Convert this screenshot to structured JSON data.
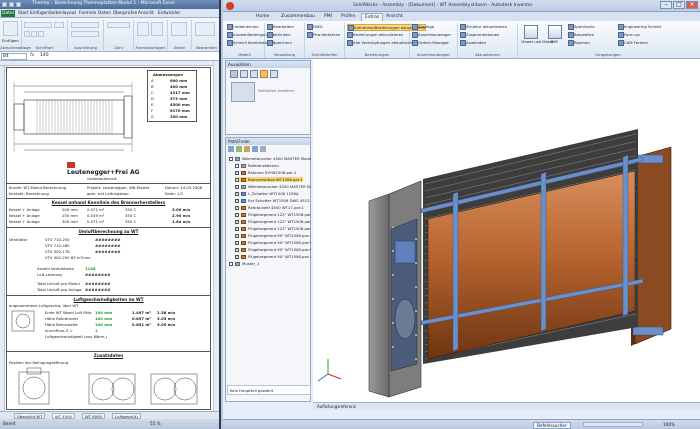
{
  "excel": {
    "title": "Thermo... Berechnung  Thermoplatten-Modul 1 - Microsoft Excel",
    "file_tab": "Datei",
    "tabs": [
      "Start",
      "Einfügen",
      "Seitenlayout",
      "Formeln",
      "Daten",
      "Überprüfen",
      "Ansicht",
      "Entwickler"
    ],
    "groups": [
      "Zwischenablage",
      "Schriftart",
      "Ausrichtung",
      "Zahl",
      "Formatvorlagen",
      "Zellen",
      "Bearbeiten"
    ],
    "paste_label": "Einfügen",
    "name_box": "B4",
    "fx": "fx",
    "formula_value": "140",
    "sheet": {
      "dims_header": "Abmessungen",
      "dims": [
        {
          "k": "A",
          "v": "600 mm"
        },
        {
          "k": "B",
          "v": "400 mm"
        },
        {
          "k": "C",
          "v": "4317 mm"
        },
        {
          "k": "D",
          "v": "573 mm"
        },
        {
          "k": "E",
          "v": "4500 mm"
        },
        {
          "k": "F",
          "v": "6170 mm"
        },
        {
          "k": "G",
          "v": "200 mm"
        }
      ],
      "company": "Leutenegger+Frei AG",
      "company_sub": "Gartenbautechnik",
      "info_lines": [
        {
          "l": "Kunde: WT-Modul-Berechnung",
          "m": "Projekt: Leutenegger, WB Muster",
          "r": "Datum: 14.03.2008"
        },
        {
          "l": "Kontakt: Berechnung",
          "m": "gem. mit Leitungsbau",
          "r": "Seite: 1/1"
        }
      ],
      "kessel_header": "Kessel anhand Kennlinie des Brennerherstellers",
      "kessel_rows": [
        {
          "a": "Kessel + Anlage",
          "b": "200 mm",
          "c": "0.071 m²",
          "d": "350 C",
          "e": "3.00 m/s"
        },
        {
          "a": "Kessel + Anlage",
          "b": "250 mm",
          "c": "0.049 m²",
          "d": "350 C",
          "e": "2.90 m/s"
        },
        {
          "a": "Kessel + Anlage",
          "b": "300 mm",
          "c": "0.071 m²",
          "d": "350 C",
          "e": "1.84 m/s"
        }
      ],
      "umluft_header": "Umluftberechnung zu WT",
      "umluft_label": "Ventilator",
      "umluft_rows": [
        "VTV 710-250",
        "VTV 710-280",
        "VTV 500-178",
        "VTV 400-250  65 m³/min"
      ],
      "umluft_hashes": "########",
      "anzahl_label": "Anzahl Ventilatoren",
      "anzahl_value": "1146",
      "luft_label": "Luft-Leistung",
      "total_labels": [
        "Total Umluft pro Modul",
        "Total Umluft pro Anlage"
      ],
      "waerme_header": "Luftgeschwindigkeiten im WT",
      "waerme_sub": "angenommene Luftgeschw. über WT",
      "waerme_rows": [
        {
          "l": "Ende WT Wand Luft Rille",
          "v": "100 mm",
          "x": "1.497 m²",
          "y": "2.58 m/s"
        },
        {
          "l": "Höhe Rohrbündel",
          "v": "100 mm",
          "x": "0.897 m²",
          "y": "3.05 m/s"
        },
        {
          "l": "Höhe Brennweite",
          "v": "100 mm",
          "x": "0.851 m²",
          "y": "3.05 m/s"
        },
        {
          "l": "durchfluss Z =",
          "v": "1",
          "x": "",
          "y": ""
        },
        {
          "l": "Luftgeschwindigkeit (aus Wärm.)",
          "v": "",
          "x": "",
          "y": ""
        }
      ],
      "zusatz_header": "Zusatzdaten",
      "position_label": "Position der Reinigungsöffnung"
    },
    "sheet_tabs": [
      "Übersicht WT",
      "WT 4500",
      "WT 6000",
      "Luftgesch(t)"
    ],
    "status": {
      "ready": "Bereit",
      "zoom": "55 %"
    }
  },
  "cad": {
    "title": "SolidWorks - Assembly - [Dokument] - WT Assembly.sldasm - Autodesk Inventor",
    "window_controls": [
      "–",
      "□",
      "✕"
    ],
    "tabs": [
      "Home",
      "Zusammenbau",
      "PMI",
      "Prüfen",
      "Extras",
      "Ansicht"
    ],
    "active_tab": "Extras",
    "groups": [
      {
        "label": "Modell",
        "items": [
          "Umbenennen",
          "Auswahlbedingungen",
          "Schnell Kombinatoren"
        ]
      },
      {
        "label": "Verwaltung",
        "items": [
          "Bearbeiten",
          "Verlinken",
          "Speichern"
        ]
      },
      {
        "label": "Schnittstellen",
        "items": [
          "DWG",
          "Pkw-Verfahren"
        ]
      },
      {
        "label": "Beziehungen",
        "items": [
          "Aufnahme/Beziehungen aktualisieren",
          "Beziehungen aktualisieren",
          "Alle Verknüpfungen aktualisieren"
        ]
      },
      {
        "label": "Ansichtsmanager",
        "items": [
          "Auszüge",
          "Ansichtsmanager",
          "Ordner-Manager"
        ]
      },
      {
        "label": "Aktualisieren",
        "items": [
          "Struktur aktualisieren",
          "Zusammenbauen",
          "Anwenden"
        ]
      },
      {
        "label": "Umgebungen",
        "items": [
          "Sperrfache",
          "Baustellen",
          "Raumen",
          "Engineering Schnitt",
          "Form-up",
          "CAM Formen"
        ]
      }
    ],
    "big_buttons": [
      "Viewer und Maker",
      "BIM"
    ],
    "selection_panel": {
      "header": "Auswählen",
      "button": "Definition erstellen"
    },
    "tree_panel": {
      "header": "PathFinder",
      "items": [
        {
          "text": "Wärmetauscher 4500 MASTER Montage.asm",
          "icon": "grey",
          "check": false,
          "indent": 0,
          "sel": false
        },
        {
          "text": "Referenzebenen",
          "icon": "grey",
          "check": false,
          "indent": 1,
          "sel": false
        },
        {
          "text": "Rahmen SV*W1506.par:1",
          "icon": "orange",
          "check": true,
          "indent": 1,
          "sel": false
        },
        {
          "text": "Brennerstütze WT1506.par:1",
          "icon": "orange",
          "check": true,
          "indent": 1,
          "sel": true
        },
        {
          "text": "Wärmetauscher 4500 MASTER Einbau",
          "icon": "grey",
          "check": true,
          "indent": 1,
          "sel": false
        },
        {
          "text": "L_Schotter WT1506 1258A",
          "icon": "blue",
          "check": true,
          "indent": 1,
          "sel": false
        },
        {
          "text": "Ext Schotter WT1506 DWS 4513",
          "icon": "blue",
          "check": true,
          "indent": 1,
          "sel": false
        },
        {
          "text": "Rohrbündel 4500 WT17.par:1",
          "icon": "orange",
          "check": true,
          "indent": 1,
          "sel": false
        },
        {
          "text": "Flügelsegment 122\" WT1506.par:1",
          "icon": "orange",
          "check": true,
          "indent": 1,
          "sel": false
        },
        {
          "text": "Flügelsegment 122\" WT1506.par:2",
          "icon": "orange",
          "check": true,
          "indent": 1,
          "sel": false
        },
        {
          "text": "Flügelsegment 122\" WT1506.par:3",
          "icon": "orange",
          "check": true,
          "indent": 1,
          "sel": false
        },
        {
          "text": "Flügelsegment 90\" WT1506.par:4",
          "icon": "orange",
          "check": true,
          "indent": 1,
          "sel": false
        },
        {
          "text": "Flügelsegment 90\" WT1506.par:5",
          "icon": "orange",
          "check": true,
          "indent": 1,
          "sel": false
        },
        {
          "text": "Flügelsegment 90\" WT1506.par:6",
          "icon": "orange",
          "check": true,
          "indent": 1,
          "sel": false
        },
        {
          "text": "Flügelsegment 90\" WT1506.par:7",
          "icon": "orange",
          "check": true,
          "indent": 1,
          "sel": false
        },
        {
          "text": "Muster_1",
          "icon": "grey",
          "check": false,
          "indent": 0,
          "sel": false
        }
      ],
      "footer": "Kein Hauptteil gewählt"
    },
    "viewport_footer": "Auflistungsreferenz",
    "status": {
      "left": "Befehlssucher",
      "right": "100%"
    }
  },
  "colors": {
    "accent": "#6b90c9",
    "tube": "#b86a3c",
    "frame": "#8a8a8a",
    "excel_green": "#1f7a3a",
    "highlight": "#f6d77a"
  }
}
